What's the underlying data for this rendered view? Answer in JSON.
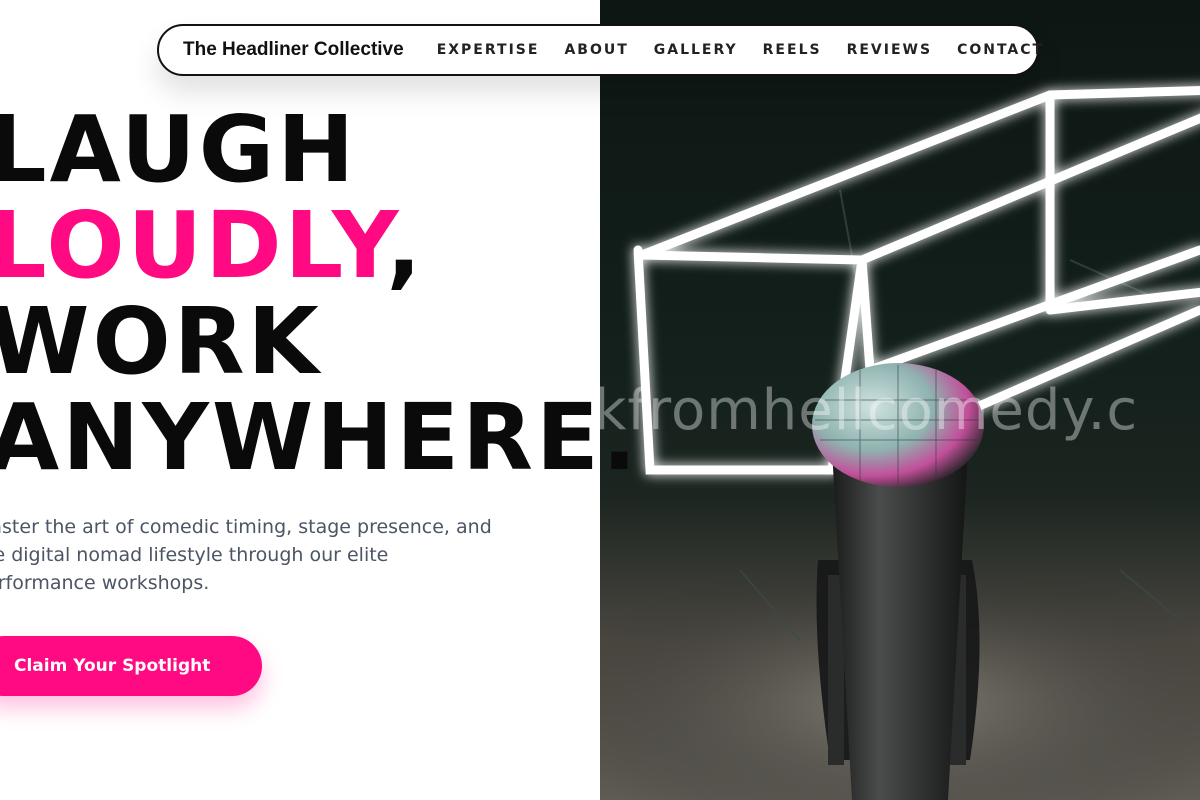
{
  "nav": {
    "brand": "The Headliner Collective",
    "links": [
      "EXPERTISE",
      "ABOUT",
      "GALLERY",
      "REELS",
      "REVIEWS",
      "CONTACT"
    ]
  },
  "hero": {
    "headline": {
      "line1": "LAUGH",
      "line2_accent": "LOUDLY",
      "line2_rest": ",",
      "line3": "WORK",
      "line4": "ANYWHERE."
    },
    "subcopy": "Master the art of comedic timing, stage presence, and the digital nomad lifestyle through our elite performance workshops.",
    "cta_label": "Claim Your Spotlight",
    "photo": {
      "watermark": "kfromhellcomedy.c",
      "subject": "microphone-on-stage-neon-cube"
    }
  },
  "colors": {
    "accent": "#ff0a82",
    "text": "#0a0a0a",
    "muted": "#4b5563"
  }
}
